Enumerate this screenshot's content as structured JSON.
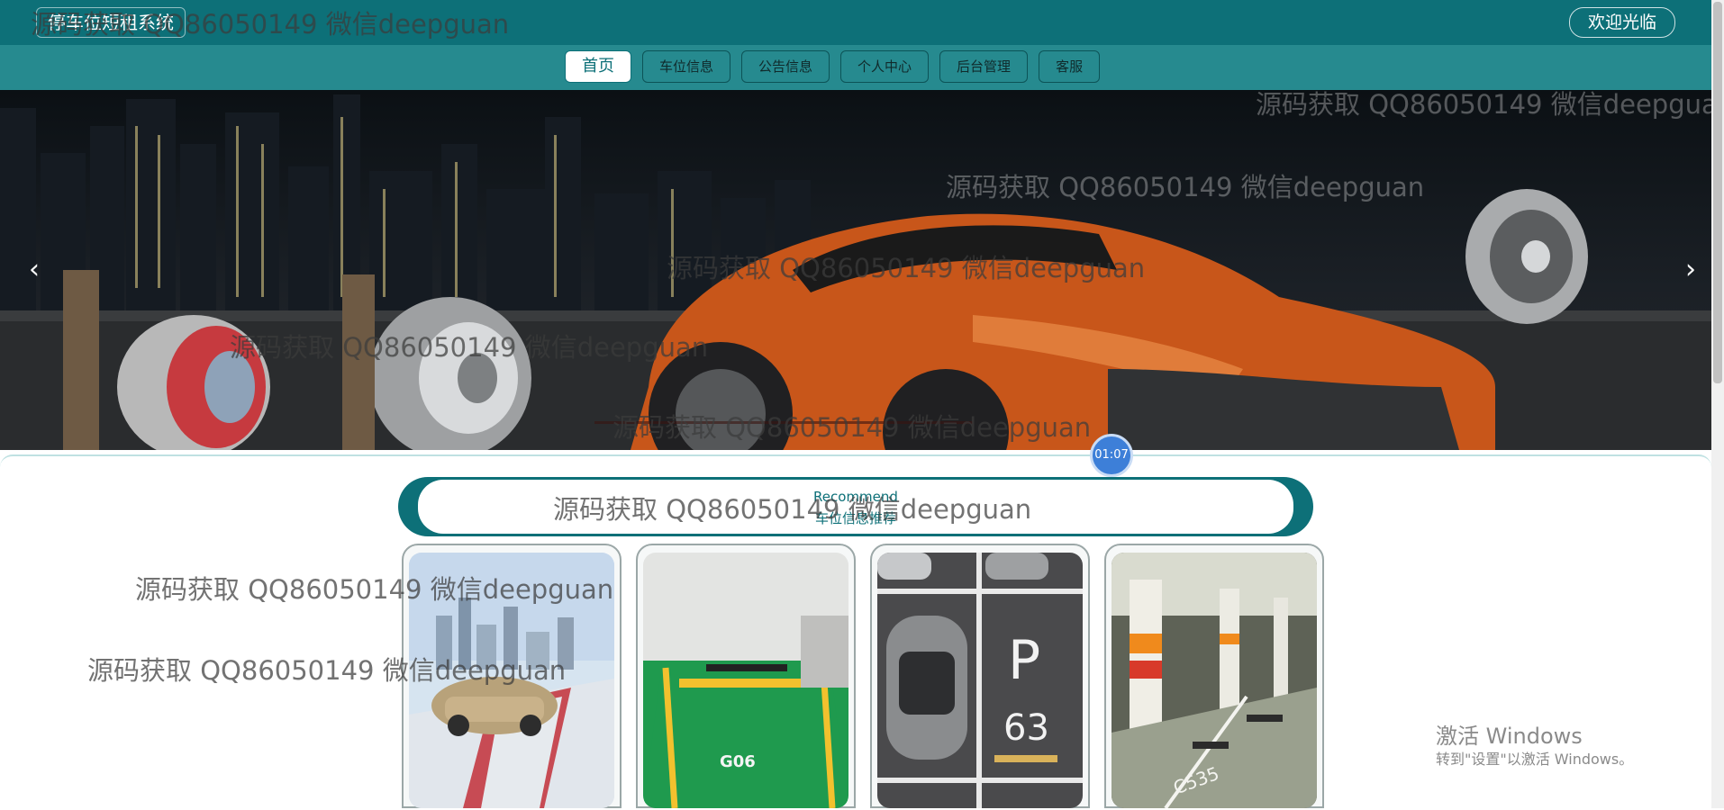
{
  "header": {
    "site_title": "停车位短租系统",
    "welcome_label": "欢迎光临"
  },
  "nav": {
    "items": [
      {
        "label": "首页",
        "active": true
      },
      {
        "label": "车位信息"
      },
      {
        "label": "公告信息"
      },
      {
        "label": "个人中心"
      },
      {
        "label": "后台管理"
      },
      {
        "label": "客服"
      }
    ]
  },
  "banner": {
    "prev_icon": "chevron-left-icon",
    "next_icon": "chevron-right-icon",
    "timer": "01:07"
  },
  "recommend": {
    "title_en": "Recommend",
    "title_cn": "车位信息推荐",
    "card_images": [
      "car-on-road-image",
      "parking-space-g06-image",
      "parking-space-p63-image",
      "underground-garage-image"
    ]
  },
  "watermark": {
    "text": "源码获取 QQ86050149 微信deepguan"
  },
  "windows_activation": {
    "line1": "激活 Windows",
    "line2": "转到\"设置\"以激活 Windows。"
  },
  "colors": {
    "primary": "#0d7078",
    "nav_bg": "#268a8f",
    "timer": "#3d7fd8"
  }
}
